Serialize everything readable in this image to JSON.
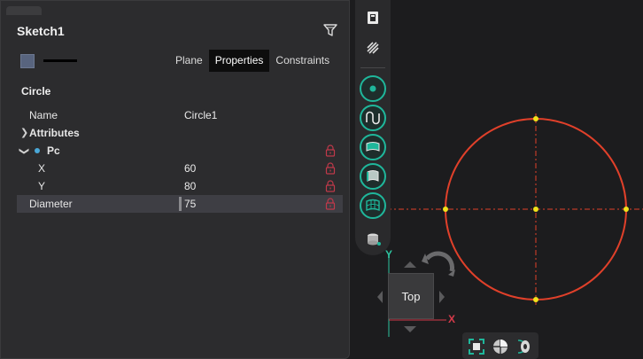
{
  "panel": {
    "title": "Sketch1",
    "tabs": [
      {
        "label": "Plane"
      },
      {
        "label": "Properties",
        "active": true
      },
      {
        "label": "Constraints"
      }
    ],
    "section_title": "Circle",
    "rows": {
      "name": {
        "label": "Name",
        "value": "Circle1"
      },
      "attributes": {
        "label": "Attributes"
      },
      "pc": {
        "label": "Pc"
      },
      "x": {
        "label": "X",
        "value": "60"
      },
      "y": {
        "label": "Y",
        "value": "80"
      },
      "diameter": {
        "label": "Diameter",
        "value": "75"
      }
    }
  },
  "viewcube": {
    "face_label": "Top",
    "axis_x": "X",
    "axis_y": "Y"
  },
  "colors": {
    "accent": "#1fb79b",
    "circle": "#e0402a",
    "point": "#f2e21a",
    "lock": "#c0394a",
    "axis_x": "#d63a4a",
    "axis_y": "#2ec4a0"
  },
  "icons": {
    "filter": "funnel-icon",
    "lock": "lock-icon"
  }
}
